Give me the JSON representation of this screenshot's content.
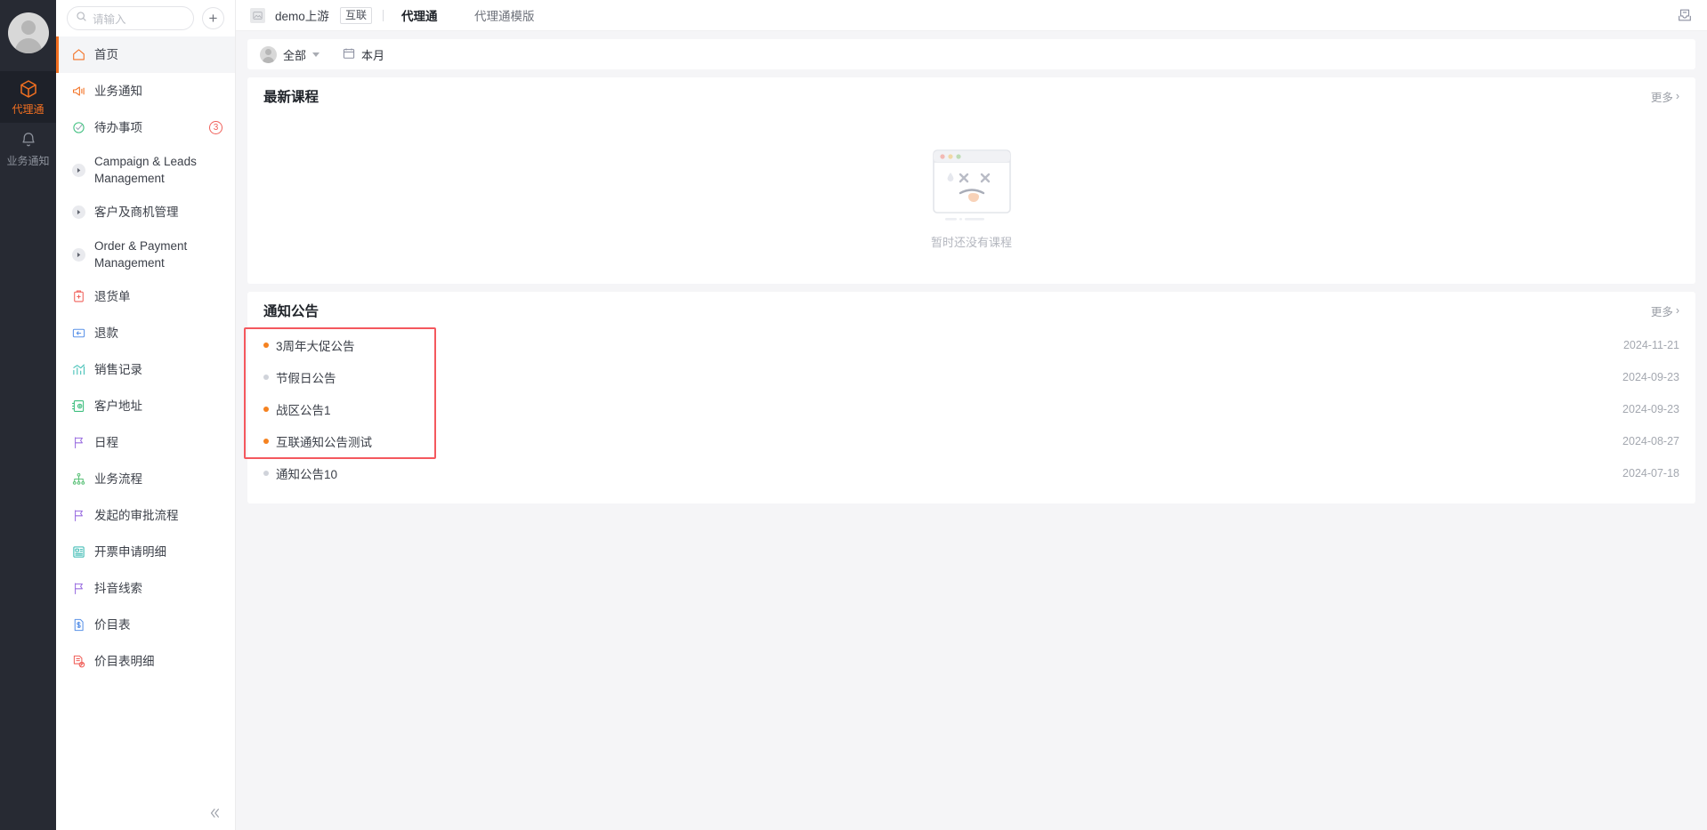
{
  "rail": {
    "avatar_name": "user-avatar",
    "items": [
      {
        "label": "代理通",
        "icon": "cube-icon",
        "active": true
      },
      {
        "label": "业务通知",
        "icon": "bell-icon",
        "active": false
      }
    ]
  },
  "sidebar": {
    "search": {
      "placeholder": "请输入",
      "icon": "search-icon"
    },
    "add_button_label": "+",
    "collapse_icon": "chevron-double-left-icon",
    "items": [
      {
        "label": "首页",
        "icon": "home-icon",
        "color": "#f37021",
        "active": true,
        "type": "link"
      },
      {
        "label": "业务通知",
        "icon": "megaphone-icon",
        "color": "#f37021",
        "type": "link"
      },
      {
        "label": "待办事项",
        "icon": "check-circle-icon",
        "color": "#3fbf7f",
        "badge": "3",
        "type": "link"
      },
      {
        "label": "Campaign & Leads Management",
        "icon": "caret-right-icon",
        "type": "group"
      },
      {
        "label": "客户及商机管理",
        "icon": "caret-right-icon",
        "type": "group"
      },
      {
        "label": "Order & Payment Management",
        "icon": "caret-right-icon",
        "type": "group"
      },
      {
        "label": "退货单",
        "icon": "clipboard-icon",
        "color": "#f0615b",
        "type": "link"
      },
      {
        "label": "退款",
        "icon": "refund-card-icon",
        "color": "#5b93e8",
        "type": "link"
      },
      {
        "label": "销售记录",
        "icon": "chart-line-icon",
        "color": "#3fbfb5",
        "type": "link"
      },
      {
        "label": "客户地址",
        "icon": "address-book-icon",
        "color": "#3fbf7f",
        "type": "link"
      },
      {
        "label": "日程",
        "icon": "flag-icon",
        "color": "#9a6de0",
        "type": "link"
      },
      {
        "label": "业务流程",
        "icon": "sitemap-icon",
        "color": "#5dc27a",
        "type": "link"
      },
      {
        "label": "发起的审批流程",
        "icon": "flag-icon",
        "color": "#9a6de0",
        "type": "link"
      },
      {
        "label": "开票申请明细",
        "icon": "invoice-icon",
        "color": "#35b8b0",
        "type": "link"
      },
      {
        "label": "抖音线索",
        "icon": "flag-icon",
        "color": "#9a6de0",
        "type": "link"
      },
      {
        "label": "价目表",
        "icon": "price-doc-icon",
        "color": "#5b93e8",
        "type": "link"
      },
      {
        "label": "价目表明细",
        "icon": "price-detail-icon",
        "color": "#f0615b",
        "type": "link"
      }
    ]
  },
  "topbar": {
    "logo_icon": "image-placeholder-icon",
    "org_name": "demo上游",
    "chip": "互联",
    "tabs": [
      {
        "label": "代理通",
        "active": true
      },
      {
        "label": "代理通模版",
        "active": false
      }
    ],
    "right_icon": "inbox-icon"
  },
  "filterbar": {
    "scope": {
      "label": "全部",
      "icon": "user-avatar-icon",
      "caret": "chevron-down-icon"
    },
    "period": {
      "label": "本月",
      "icon": "calendar-icon"
    }
  },
  "courses_card": {
    "title": "最新课程",
    "more_label": "更多",
    "more_chevron": "›",
    "empty_text": "暂时还没有课程",
    "empty_illustration": "sad-browser-window-icon"
  },
  "notices_card": {
    "title": "通知公告",
    "more_label": "更多",
    "more_chevron": "›",
    "unread_color": "#f58220",
    "read_color": "#d0d3da",
    "highlight_color": "#f4585e",
    "rows": [
      {
        "title": "3周年大促公告",
        "date": "2024-11-21",
        "unread": true
      },
      {
        "title": "节假日公告",
        "date": "2024-09-23",
        "unread": false
      },
      {
        "title": "战区公告1",
        "date": "2024-09-23",
        "unread": true
      },
      {
        "title": "互联通知公告测试",
        "date": "2024-08-27",
        "unread": true
      },
      {
        "title": "通知公告10",
        "date": "2024-07-18",
        "unread": false
      }
    ]
  }
}
